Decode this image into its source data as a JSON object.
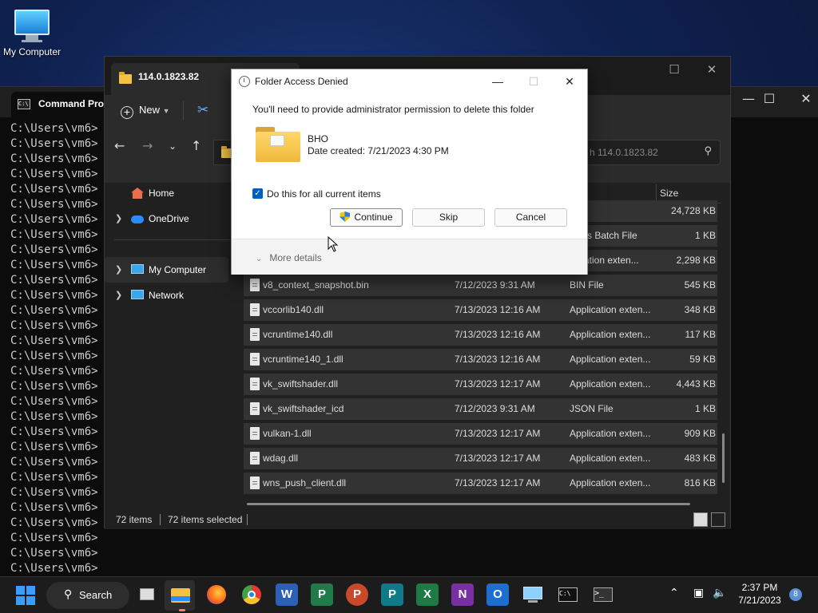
{
  "desktop": {
    "icon_label": "My Computer"
  },
  "cmd": {
    "title": "Command Prompt",
    "lines": [
      "C:\\Users\\vm6>",
      "C:\\Users\\vm6>",
      "C:\\Users\\vm6>",
      "C:\\Users\\vm6>",
      "C:\\Users\\vm6>",
      "C:\\Users\\vm6>",
      "C:\\Users\\vm6>",
      "C:\\Users\\vm6>",
      "C:\\Users\\vm6>",
      "C:\\Users\\vm6>",
      "C:\\Users\\vm6>",
      "C:\\Users\\vm6>",
      "C:\\Users\\vm6>",
      "C:\\Users\\vm6>",
      "C:\\Users\\vm6>",
      "C:\\Users\\vm6>",
      "C:\\Users\\vm6>",
      "C:\\Users\\vm6>",
      "C:\\Users\\vm6>",
      "C:\\Users\\vm6>",
      "C:\\Users\\vm6>",
      "C:\\Users\\vm6>",
      "C:\\Users\\vm6>",
      "C:\\Users\\vm6>",
      "C:\\Users\\vm6>",
      "C:\\Users\\vm6>",
      "C:\\Users\\vm6>",
      "C:\\Users\\vm6>",
      "C:\\Users\\vm6>",
      "C:\\Users\\vm6>",
      "C:\\Users\\vm6>"
    ]
  },
  "explorer": {
    "tab_title": "114.0.1823.82",
    "new_label": "New",
    "search_placeholder": "h 114.0.1823.82",
    "nav": {
      "home": "Home",
      "onedrive": "OneDrive",
      "my_computer": "My Computer",
      "network": "Network"
    },
    "size_header": "Size",
    "files": [
      {
        "name": "",
        "date": "",
        "type": "File",
        "size": "24,728 KB"
      },
      {
        "name": "",
        "date": "",
        "type": "dows Batch File",
        "size": "1 KB"
      },
      {
        "name": "",
        "date": "",
        "type": "plication exten...",
        "size": "2,298 KB"
      },
      {
        "name": "v8_context_snapshot.bin",
        "date": "7/12/2023 9:31 AM",
        "type": "BIN File",
        "size": "545 KB"
      },
      {
        "name": "vccorlib140.dll",
        "date": "7/13/2023 12:16 AM",
        "type": "Application exten...",
        "size": "348 KB"
      },
      {
        "name": "vcruntime140.dll",
        "date": "7/13/2023 12:16 AM",
        "type": "Application exten...",
        "size": "117 KB"
      },
      {
        "name": "vcruntime140_1.dll",
        "date": "7/13/2023 12:16 AM",
        "type": "Application exten...",
        "size": "59 KB"
      },
      {
        "name": "vk_swiftshader.dll",
        "date": "7/13/2023 12:17 AM",
        "type": "Application exten...",
        "size": "4,443 KB"
      },
      {
        "name": "vk_swiftshader_icd",
        "date": "7/12/2023 9:31 AM",
        "type": "JSON File",
        "size": "1 KB"
      },
      {
        "name": "vulkan-1.dll",
        "date": "7/13/2023 12:17 AM",
        "type": "Application exten...",
        "size": "909 KB"
      },
      {
        "name": "wdag.dll",
        "date": "7/13/2023 12:17 AM",
        "type": "Application exten...",
        "size": "483 KB"
      },
      {
        "name": "wns_push_client.dll",
        "date": "7/13/2023 12:17 AM",
        "type": "Application exten...",
        "size": "816 KB"
      }
    ],
    "status_items": "72 items",
    "status_selected": "72 items selected"
  },
  "dialog": {
    "title": "Folder Access Denied",
    "message": "You'll need to provide administrator permission to delete this folder",
    "folder_name": "BHO",
    "folder_date": "Date created: 7/21/2023 4:30 PM",
    "checkbox_label": "Do this for all current items",
    "checkbox_checked": true,
    "continue_label": "Continue",
    "skip_label": "Skip",
    "cancel_label": "Cancel",
    "more_details": "More details"
  },
  "taskbar": {
    "search_label": "Search",
    "time": "2:37 PM",
    "date": "7/21/2023",
    "notification_count": "8",
    "colors": {
      "accent": "#3a9cff",
      "word": "#2b5fb8",
      "excel": "#1e7a45",
      "powerpoint": "#c94a2a",
      "onenote": "#7a2fa3",
      "outlook": "#1a6fd1",
      "project": "#217a4a",
      "publisher": "#0f7a8a"
    }
  }
}
